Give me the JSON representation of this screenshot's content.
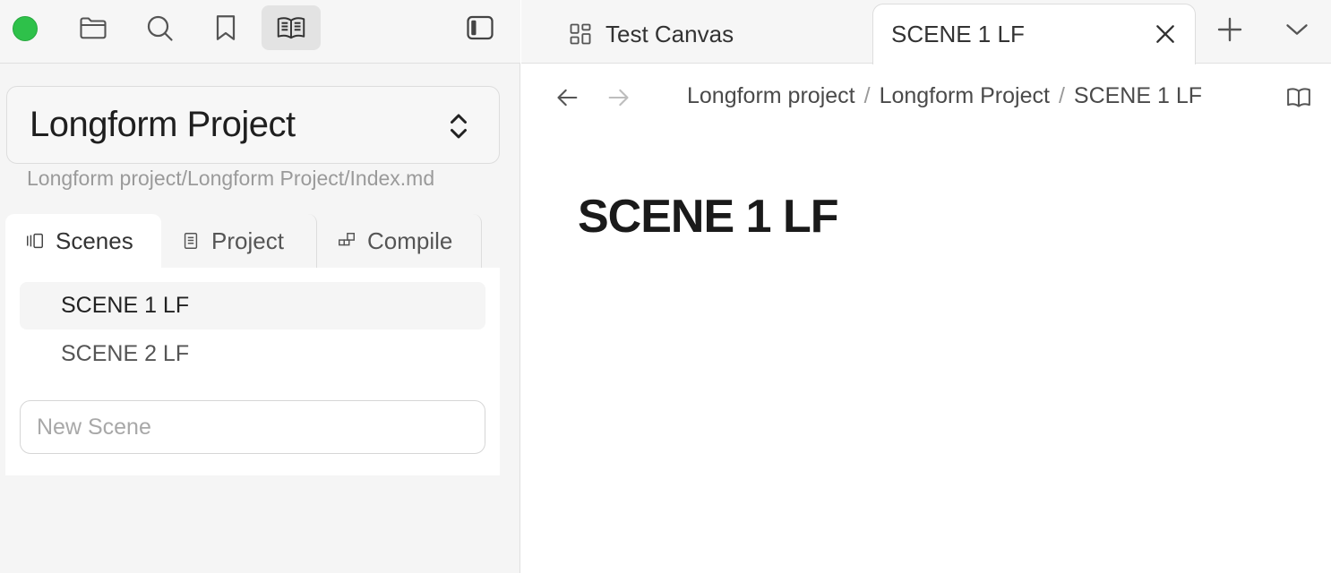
{
  "sidebar": {
    "ribbon": {
      "status_color": "#2ec14a",
      "buttons": [
        {
          "icon": "folder-icon"
        },
        {
          "icon": "search-icon"
        },
        {
          "icon": "bookmark-icon"
        },
        {
          "icon": "book-open-icon",
          "active": true
        }
      ],
      "collapse_icon": "sidebar-toggle-icon"
    },
    "project": {
      "name": "Longform Project",
      "path": "Longform project/Longform Project/Index.md"
    },
    "tabs": [
      {
        "label": "Scenes",
        "icon": "scenes-icon",
        "active": true
      },
      {
        "label": "Project",
        "icon": "project-icon"
      },
      {
        "label": "Compile",
        "icon": "compile-icon"
      }
    ],
    "scenes": [
      {
        "label": "SCENE 1 LF",
        "selected": true
      },
      {
        "label": "SCENE 2 LF"
      }
    ],
    "new_scene_placeholder": "New Scene"
  },
  "tabbar": {
    "tabs": [
      {
        "label": "Test Canvas",
        "icon": "canvas-grid-icon"
      },
      {
        "label": "SCENE 1 LF",
        "active": true
      }
    ]
  },
  "header": {
    "breadcrumb": [
      "Longform project",
      "Longform Project",
      "SCENE 1 LF"
    ],
    "separator": "/"
  },
  "document": {
    "title": "SCENE 1 LF"
  }
}
